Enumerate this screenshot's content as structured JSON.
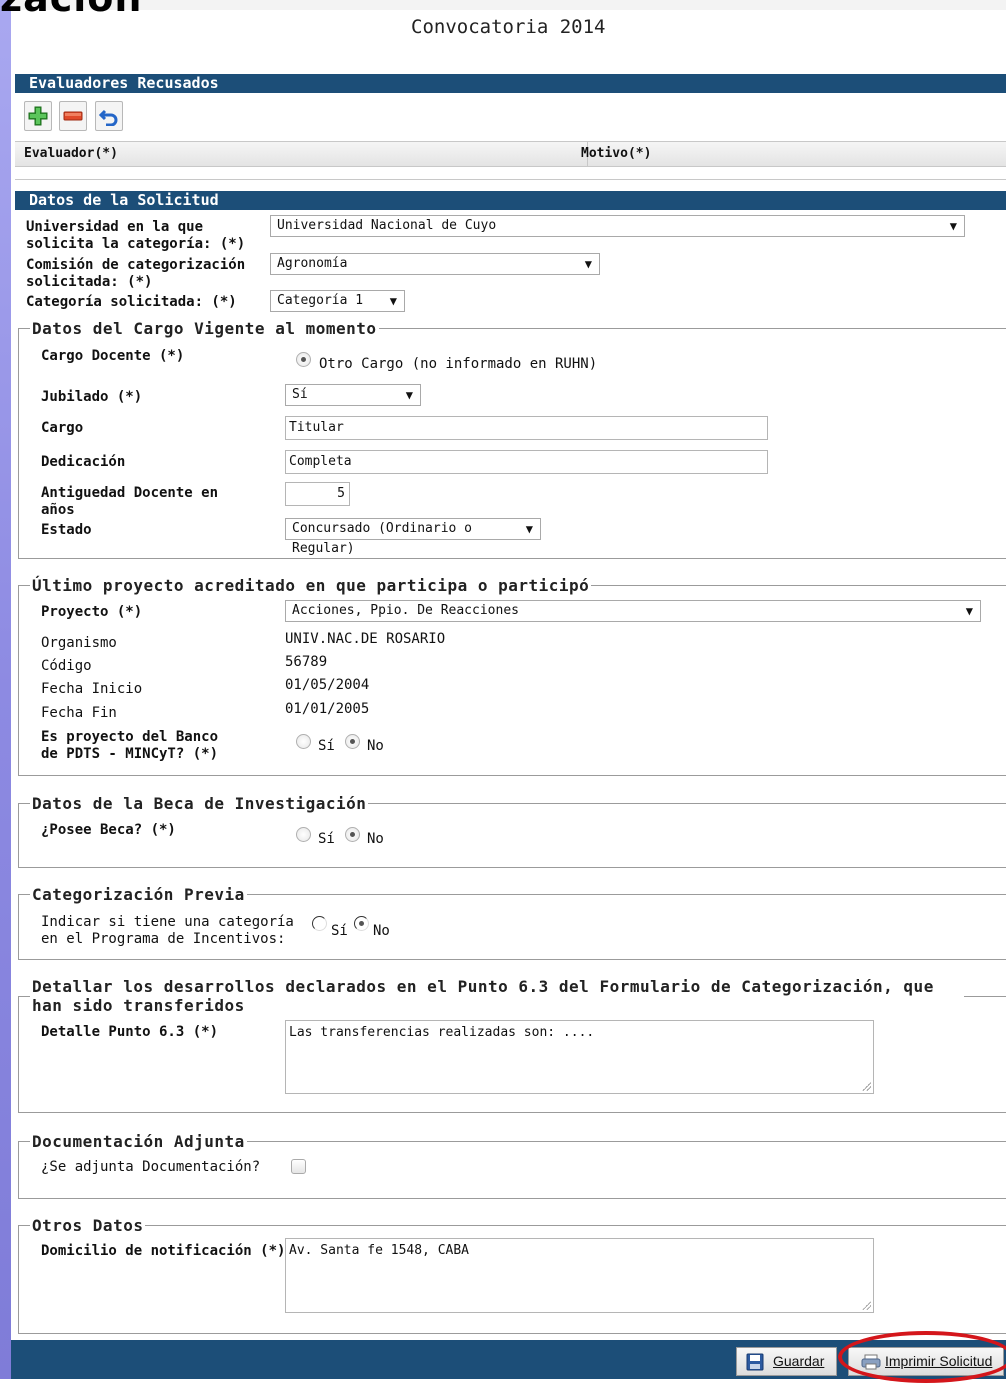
{
  "header": {
    "cut_title": "zación",
    "page_title": "Convocatoria 2014"
  },
  "evaluadores": {
    "title": "Evaluadores Recusados",
    "toolbar": {
      "add_icon": "plus-icon",
      "remove_icon": "minus-icon",
      "undo_icon": "undo-icon"
    },
    "columns": [
      "Evaluador(*)",
      "Motivo(*)"
    ]
  },
  "solicitud": {
    "title": "Datos de la Solicitud",
    "universidad_label": "Universidad en la que solicita la categoría: (*)",
    "universidad_value": "Universidad Nacional de Cuyo",
    "comision_label": "Comisión de categorización solicitada: (*)",
    "comision_value": "Agronomía",
    "categoria_label": "Categoría solicitada: (*)",
    "categoria_value": "Categoría 1"
  },
  "cargo": {
    "legend": "Datos del Cargo Vigente al momento",
    "cargo_docente_label": "Cargo Docente (*)",
    "cargo_docente_option": "Otro Cargo (no informado en RUHN)",
    "jubilado_label": "Jubilado (*)",
    "jubilado_value": "Sí",
    "cargo_label": "Cargo",
    "cargo_value": "Titular",
    "dedicacion_label": "Dedicación",
    "dedicacion_value": "Completa",
    "antiguedad_label": "Antiguedad Docente en años",
    "antiguedad_value": "5",
    "estado_label": "Estado",
    "estado_value": "Concursado (Ordinario o Regular)"
  },
  "proyecto": {
    "legend": "Último proyecto acreditado en que participa o participó",
    "proyecto_label": "Proyecto (*)",
    "proyecto_value": "Acciones, Ppio. De Reacciones",
    "organismo_label": "Organismo",
    "organismo_value": "UNIV.NAC.DE ROSARIO",
    "codigo_label": "Código",
    "codigo_value": "56789",
    "fecha_inicio_label": "Fecha Inicio",
    "fecha_inicio_value": "01/05/2004",
    "fecha_fin_label": "Fecha Fin",
    "fecha_fin_value": "01/01/2005",
    "pdts_label": "Es proyecto del Banco de PDTS - MINCyT? (*)",
    "opt_si": "Sí",
    "opt_no": "No"
  },
  "beca": {
    "legend": "Datos de la Beca de Investigación",
    "label": "¿Posee Beca? (*)",
    "opt_si": "Sí",
    "opt_no": "No"
  },
  "previa": {
    "legend": "Categorización Previa",
    "label": "Indicar si tiene una categoría en el Programa de Incentivos:",
    "opt_si": "Sí",
    "opt_no": "No"
  },
  "desarrollos": {
    "legend": "Detallar los desarrollos declarados en el Punto 6.3 del Formulario de Categorización, que han sido transferidos",
    "label": "Detalle Punto 6.3 (*)",
    "value": "Las transferencias realizadas son: ...."
  },
  "documentacion": {
    "legend": "Documentación Adjunta",
    "label": "¿Se adjunta Documentación?"
  },
  "otros": {
    "legend": "Otros Datos",
    "label": "Domicilio de notificación (*)",
    "value": "Av. Santa fe 1548, CABA"
  },
  "footer": {
    "guardar_label": "Guardar",
    "guardar_icon": "floppy-disk-icon",
    "imprimir_label": "Imprimir Solicitud",
    "imprimir_icon": "printer-icon",
    "highlight_color": "#d4161b"
  },
  "colors": {
    "section_bar": "#1c4e78",
    "left_gradient": "#8d8ae2"
  }
}
